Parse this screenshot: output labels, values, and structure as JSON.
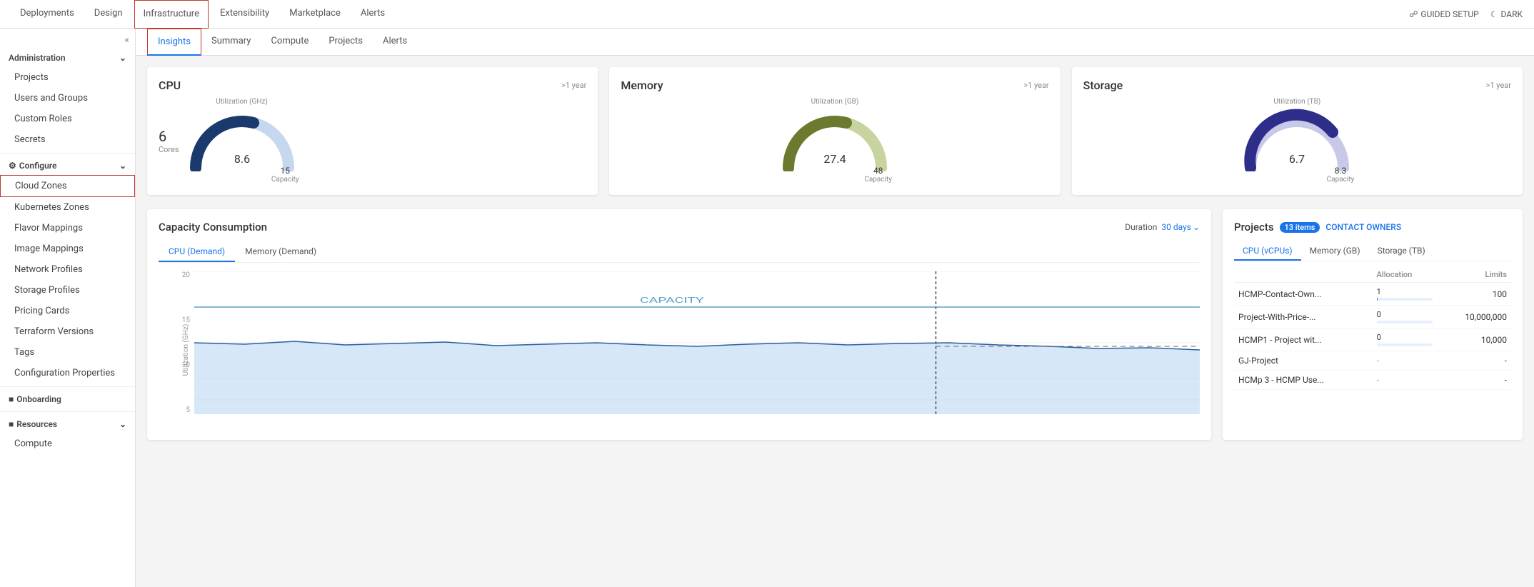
{
  "topNav": {
    "items": [
      {
        "label": "Deployments",
        "active": false
      },
      {
        "label": "Design",
        "active": false
      },
      {
        "label": "Infrastructure",
        "active": true,
        "highlighted": true
      },
      {
        "label": "Extensibility",
        "active": false
      },
      {
        "label": "Marketplace",
        "active": false
      },
      {
        "label": "Alerts",
        "active": false
      }
    ],
    "guidedSetup": "GUIDED SETUP",
    "darkMode": "DARK"
  },
  "sidebar": {
    "collapseLabel": "«",
    "sections": [
      {
        "label": "Administration",
        "items": [
          {
            "label": "Projects"
          },
          {
            "label": "Users and Groups"
          },
          {
            "label": "Custom Roles"
          },
          {
            "label": "Secrets"
          }
        ]
      },
      {
        "label": "Configure",
        "items": [
          {
            "label": "Cloud Zones",
            "highlighted": true
          },
          {
            "label": "Kubernetes Zones"
          },
          {
            "label": "Flavor Mappings"
          },
          {
            "label": "Image Mappings"
          },
          {
            "label": "Network Profiles"
          },
          {
            "label": "Storage Profiles"
          },
          {
            "label": "Pricing Cards"
          },
          {
            "label": "Terraform Versions"
          },
          {
            "label": "Tags"
          },
          {
            "label": "Configuration Properties"
          }
        ]
      },
      {
        "label": "Onboarding",
        "items": []
      },
      {
        "label": "Resources",
        "items": [
          {
            "label": "Compute"
          }
        ]
      }
    ]
  },
  "subNav": {
    "items": [
      {
        "label": "Insights",
        "active": true,
        "highlighted": true
      },
      {
        "label": "Summary"
      },
      {
        "label": "Compute"
      },
      {
        "label": "Projects"
      },
      {
        "label": "Alerts"
      }
    ]
  },
  "metrics": {
    "cpu": {
      "title": "CPU",
      "time": ">1 year",
      "cores": "6",
      "coresLabel": "Cores",
      "utilization": "8.6",
      "capacity": "15",
      "capacityLabel": "Capacity",
      "unitLabel": "Utilization (GHz)",
      "fillPercent": 57,
      "colors": {
        "fill": "#1a3a6e",
        "track": "#c5d8f0"
      }
    },
    "memory": {
      "title": "Memory",
      "time": ">1 year",
      "utilization": "27.4",
      "capacity": "48",
      "capacityLabel": "Capacity",
      "unitLabel": "Utilization (GB)",
      "fillPercent": 57,
      "colors": {
        "fill": "#6b7a2e",
        "track": "#c8d4a0"
      }
    },
    "storage": {
      "title": "Storage",
      "time": ">1 year",
      "utilization": "6.7",
      "capacity": "8.3",
      "capacityLabel": "Capacity",
      "unitLabel": "Utilization (TB)",
      "fillPercent": 81,
      "colors": {
        "fill": "#2e2e8a",
        "track": "#c8c8e8"
      }
    }
  },
  "capacityConsumption": {
    "title": "Capacity Consumption",
    "durationLabel": "Duration",
    "duration": "30 days",
    "tabs": [
      {
        "label": "CPU (Demand)",
        "active": true
      },
      {
        "label": "Memory (Demand)",
        "active": false
      }
    ],
    "yAxisLabel": "Utilization (GHz)",
    "yLabels": [
      "20",
      "15",
      "10",
      "5"
    ],
    "capacityLineLabel": "CAPACITY",
    "capacityLineValue": 15,
    "maxY": 20
  },
  "projects": {
    "title": "Projects",
    "count": "13 items",
    "contactOwners": "CONTACT OWNERS",
    "tabs": [
      {
        "label": "CPU (vCPUs)",
        "active": true
      },
      {
        "label": "Memory (GB)",
        "active": false
      },
      {
        "label": "Storage (TB)",
        "active": false
      }
    ],
    "columns": {
      "name": "",
      "allocation": "Allocation",
      "limits": "Limits"
    },
    "rows": [
      {
        "name": "HCMP-Contact-Own...",
        "allocationBar": 1,
        "allocationMax": 100,
        "allocation": "1",
        "limits": "100"
      },
      {
        "name": "Project-With-Price-...",
        "allocationBar": 0,
        "allocationMax": 10000000,
        "allocation": "0",
        "limits": "10,000,000"
      },
      {
        "name": "HCMP1 - Project wit...",
        "allocationBar": 0,
        "allocationMax": 10000,
        "allocation": "0",
        "limits": "10,000"
      },
      {
        "name": "GJ-Project",
        "allocationBar": null,
        "allocation": "-",
        "limits": "-"
      },
      {
        "name": "HCMp 3 - HCMP Use...",
        "allocationBar": null,
        "allocation": "-",
        "limits": "-"
      }
    ]
  }
}
